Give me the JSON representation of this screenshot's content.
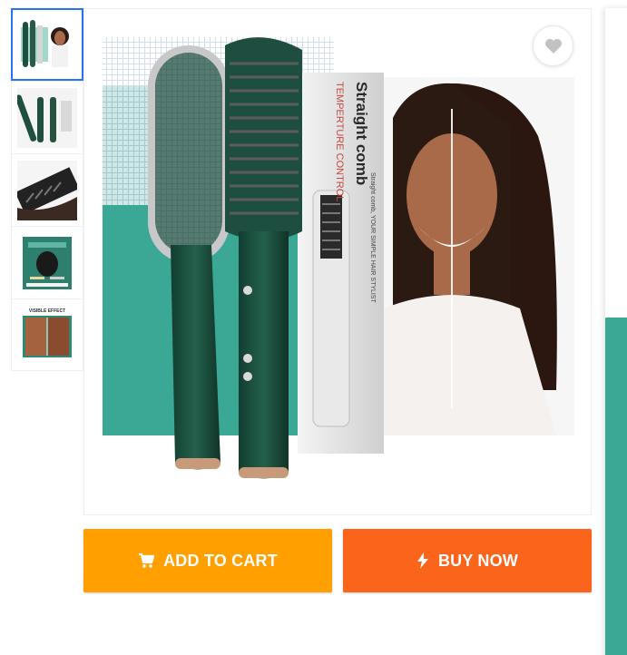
{
  "product": {
    "box_brand_text": "Straight comb",
    "box_side_text": "TEMPERTURE CONTROL",
    "box_subtext": "Straight comb, YOUR SIMPLE HAIR STYLIST"
  },
  "thumbnails": [
    {
      "name": "thumb-model-with-comb",
      "selected": true
    },
    {
      "name": "thumb-comb-set",
      "selected": false
    },
    {
      "name": "thumb-comb-closeup",
      "selected": false
    },
    {
      "name": "thumb-usage-demo",
      "selected": false
    },
    {
      "name": "thumb-visible-effect",
      "selected": false,
      "caption": "VISIBLE EFFECT"
    }
  ],
  "icons": {
    "wishlist": "heart-icon",
    "cart": "cart-icon",
    "buy": "lightning-icon"
  },
  "actions": {
    "add_to_cart": "ADD TO CART",
    "buy_now": "BUY NOW"
  },
  "colors": {
    "add_to_cart_bg": "#ff9f00",
    "buy_now_bg": "#fb641b",
    "selected_thumb_border": "#2874f0",
    "brand_teal": "#3aa895",
    "product_green": "#1f4f3f"
  }
}
